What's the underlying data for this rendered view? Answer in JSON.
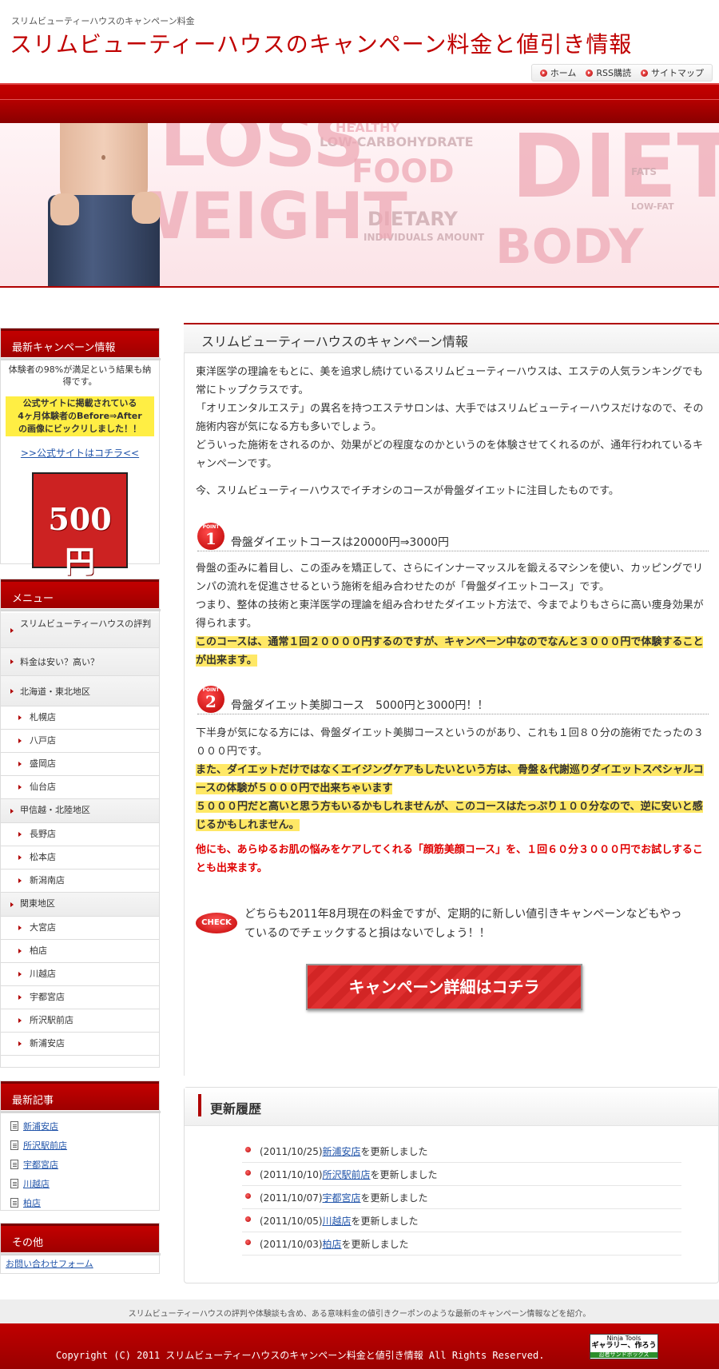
{
  "header": {
    "description": "スリムビューティーハウスのキャンペーン料金",
    "title": "スリムビューティーハウスのキャンペーン料金と値引き情報",
    "nav": [
      {
        "label": "ホーム",
        "icon": "arrow-bullet-icon"
      },
      {
        "label": "RSS購読",
        "icon": "arrow-bullet-icon"
      },
      {
        "label": "サイトマップ",
        "icon": "arrow-bullet-icon"
      }
    ]
  },
  "hero": {
    "words": [
      "HEALTHY",
      "LOW-CARBOHYDRATE",
      "FOOD",
      "DIETARY",
      "INDIVIDUALS AMOUNT",
      "DIET",
      "FATS",
      "LOW-FAT",
      "BODY",
      "WEIGHT",
      "LOSS"
    ]
  },
  "sidebar": {
    "campaign": {
      "heading": "最新キャンペーン情報",
      "text": "体験者の98%が満足という結果も納得です。",
      "highlight_line1": "公式サイトに掲載されている",
      "highlight_line2": "4ヶ月体験者のBefore⇒After",
      "highlight_line3": "の画像にビックリしました！！",
      "link": ">>公式サイトはコチラ<<",
      "badge": "500円"
    },
    "menu": {
      "heading": "メニュー",
      "items": [
        {
          "label": "スリムビューティーハウスの評判",
          "level": "main"
        },
        {
          "label": "料金は安い？高い？",
          "level": "main"
        },
        {
          "label": "北海道・東北地区",
          "level": "main"
        },
        {
          "label": "札幌店",
          "level": "sub"
        },
        {
          "label": "八戸店",
          "level": "sub"
        },
        {
          "label": "盛岡店",
          "level": "sub"
        },
        {
          "label": "仙台店",
          "level": "sub"
        },
        {
          "label": "甲信越・北陸地区",
          "level": "main"
        },
        {
          "label": "長野店",
          "level": "sub"
        },
        {
          "label": "松本店",
          "level": "sub"
        },
        {
          "label": "新潟南店",
          "level": "sub"
        },
        {
          "label": "関東地区",
          "level": "main"
        },
        {
          "label": "大宮店",
          "level": "sub"
        },
        {
          "label": "柏店",
          "level": "sub"
        },
        {
          "label": "川越店",
          "level": "sub"
        },
        {
          "label": "宇都宮店",
          "level": "sub"
        },
        {
          "label": "所沢駅前店",
          "level": "sub"
        },
        {
          "label": "新浦安店",
          "level": "sub"
        }
      ]
    },
    "recent": {
      "heading": "最新記事",
      "items": [
        "新浦安店",
        "所沢駅前店",
        "宇都宮店",
        "川越店",
        "柏店"
      ]
    },
    "other": {
      "heading": "その他",
      "link": "お問い合わせフォーム"
    }
  },
  "main": {
    "title": "スリムビューティーハウスのキャンペーン情報",
    "intro1": "東洋医学の理論をもとに、美を追求し続けているスリムビューティーハウスは、エステの人気ランキングでも常にトップクラスです。",
    "intro2": "「オリエンタルエステ」の異名を持つエステサロンは、大手ではスリムビューティーハウスだけなので、その施術内容が気になる方も多いでしょう。",
    "intro3": "どういった施術をされるのか、効果がどの程度なのかというのを体験させてくれるのが、通年行われているキャンペーンです。",
    "intro4": "今、スリムビューティーハウスでイチオシのコースが骨盤ダイエットに注目したものです。",
    "point1": {
      "badge_label": "POINT",
      "number": "1",
      "heading": "骨盤ダイエットコースは20000円⇒3000円",
      "text1": "骨盤の歪みに着目し、この歪みを矯正して、さらにインナーマッスルを鍛えるマシンを使い、カッピングでリンパの流れを促進させるという施術を組み合わせたのが「骨盤ダイエットコース」です。",
      "text2": "つまり、整体の技術と東洋医学の理論を組み合わせたダイエット方法で、今までよりもさらに高い痩身効果が得られます。",
      "highlight": "このコースは、通常１回２００００円するのですが、キャンペーン中なのでなんと３０００円で体験することが出来ます。"
    },
    "point2": {
      "badge_label": "POINT",
      "number": "2",
      "heading": "骨盤ダイエット美脚コース　5000円と3000円！！",
      "text1": "下半身が気になる方には、骨盤ダイエット美脚コースというのがあり、これも１回８０分の施術でたったの３０００円です。",
      "highlight1": "また、ダイエットだけではなくエイジングケアもしたいという方は、骨盤＆代謝巡りダイエットスペシャルコースの体験が５０００円で出来ちゃいます",
      "highlight2": "５０００円だと高いと思う方もいるかもしれませんが、このコースはたっぷり１００分なので、逆に安いと感じるかもしれません。",
      "red_text": "他にも、あらゆるお肌の悩みをケアしてくれる「顔筋美顔コース」を、１回６０分３０００円でお試しすることも出来ます。"
    },
    "check": {
      "badge": "CHECK",
      "text": "どちらも2011年8月現在の料金ですが、定期的に新しい値引きキャンペーンなどもやっているのでチェックすると損はないでしょう！！"
    },
    "cta_button": "キャンペーン詳細はコチラ"
  },
  "history": {
    "title": "更新履歴",
    "items": [
      {
        "date": "(2011/10/25)",
        "link": "新浦安店",
        "suffix": "を更新しました"
      },
      {
        "date": "(2011/10/10)",
        "link": "所沢駅前店",
        "suffix": "を更新しました"
      },
      {
        "date": "(2011/10/07)",
        "link": "宇都宮店",
        "suffix": "を更新しました"
      },
      {
        "date": "(2011/10/05)",
        "link": "川越店",
        "suffix": "を更新しました"
      },
      {
        "date": "(2011/10/03)",
        "link": "柏店",
        "suffix": "を更新しました"
      }
    ]
  },
  "footer": {
    "description": "スリムビューティーハウスの評判や体験談も含め、ある意味料金の値引きクーポンのような最新のキャンペーン情報などを紹介。",
    "copyright": "Copyright (C) 2011 スリムビューティーハウスのキャンペーン料金と値引き情報 All Rights Reserved.",
    "badge_top": "Ninja Tools",
    "badge_mid": "ギャラリー、作ろう",
    "badge_bottom": "忍者サンドボックス"
  },
  "colors": {
    "brand_red": "#c00000",
    "highlight_yellow": "#ffe866",
    "link_blue": "#2255aa"
  }
}
